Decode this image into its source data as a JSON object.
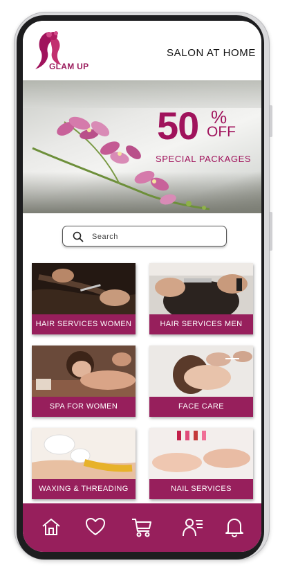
{
  "header": {
    "brand": "GLAM UP",
    "title": "SALON AT HOME"
  },
  "banner": {
    "percent": "50",
    "percent_symbol": "%",
    "off": "OFF",
    "subtitle": "SPECIAL PACKAGES"
  },
  "search": {
    "placeholder": "Search"
  },
  "services": [
    {
      "label": "HAIR SERVICES WOMEN"
    },
    {
      "label": "HAIR SERVICES MEN"
    },
    {
      "label": "SPA FOR WOMEN"
    },
    {
      "label": "FACE CARE"
    },
    {
      "label": "WAXING & THREADING"
    },
    {
      "label": "NAIL SERVICES"
    }
  ],
  "nav": {
    "icons": [
      "home-icon",
      "heart-icon",
      "cart-icon",
      "profile-list-icon",
      "bell-icon"
    ]
  },
  "colors": {
    "brand": "#971f5c",
    "accent": "#a0135c"
  }
}
